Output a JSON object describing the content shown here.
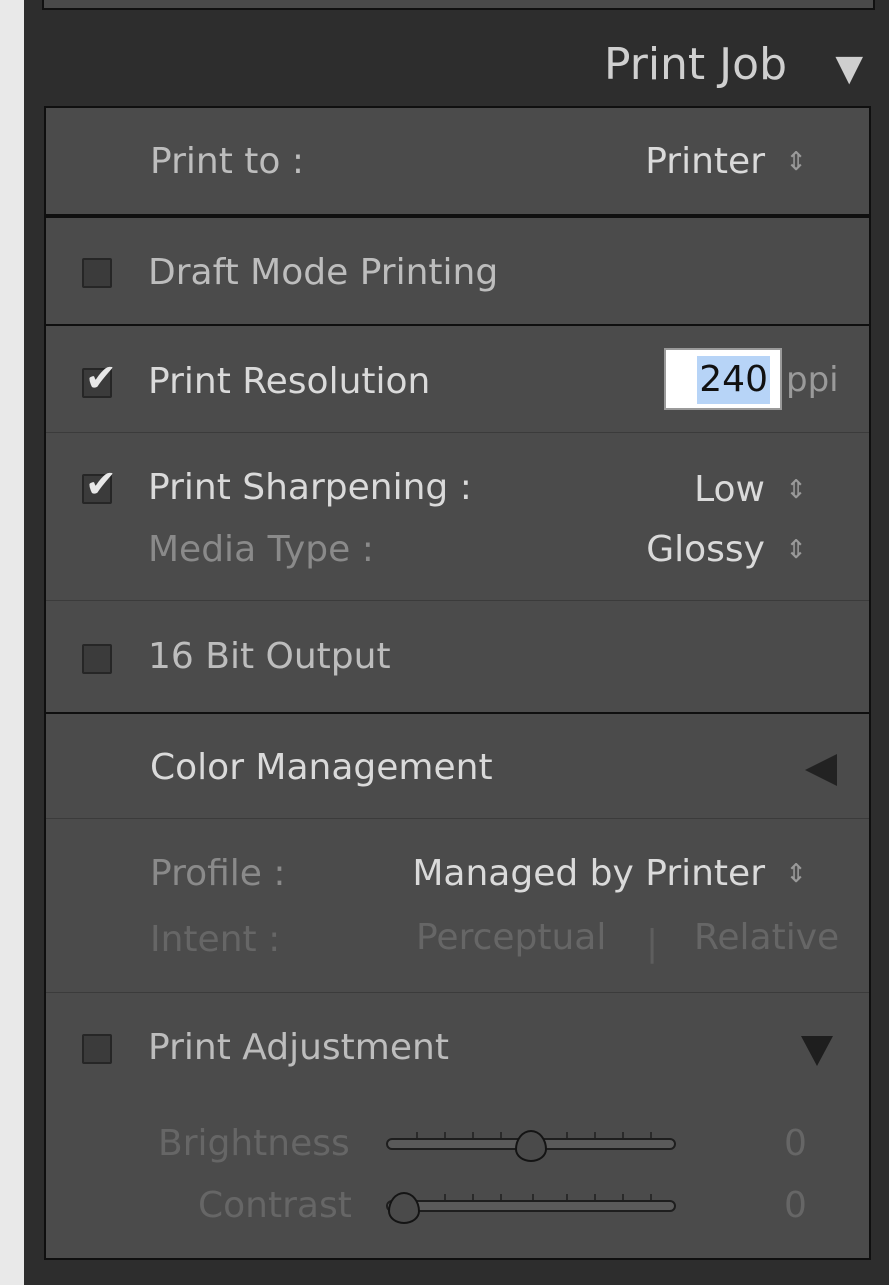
{
  "header": {
    "title": "Print Job",
    "collapse_icon": "triangle-down-icon"
  },
  "print_to": {
    "label": "Print to :",
    "value": "Printer"
  },
  "draft_mode": {
    "label": "Draft Mode Printing",
    "checked": false
  },
  "resolution": {
    "label": "Print Resolution",
    "checked": true,
    "value": "240",
    "unit": "ppi"
  },
  "sharpening": {
    "label": "Print Sharpening :",
    "checked": true,
    "value": "Low",
    "media_label": "Media Type :",
    "media_value": "Glossy"
  },
  "bit16": {
    "label": "16 Bit Output",
    "checked": false
  },
  "color_management": {
    "title": "Color Management",
    "profile_label": "Profile :",
    "profile_value": "Managed by Printer",
    "intent_label": "Intent :",
    "intent_perceptual": "Perceptual",
    "intent_sep": "|",
    "intent_relative": "Relative"
  },
  "print_adjustment": {
    "label": "Print Adjustment",
    "checked": false,
    "brightness_label": "Brightness",
    "brightness_value": "0",
    "contrast_label": "Contrast",
    "contrast_value": "0"
  },
  "stepper_glyph": "⇕",
  "check_glyph": "✔"
}
